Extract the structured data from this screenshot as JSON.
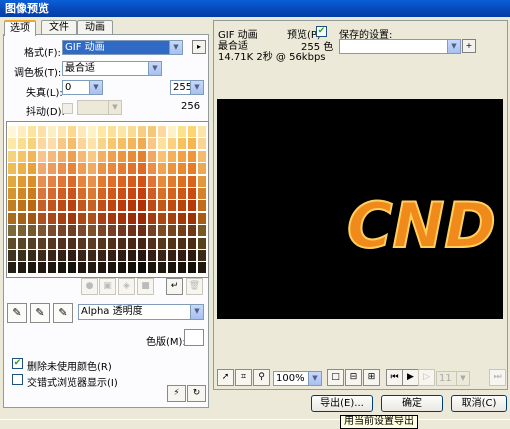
{
  "window": {
    "title": "图像预览"
  },
  "tabs": [
    {
      "label": "选项",
      "active": true
    },
    {
      "label": "文件",
      "active": false
    },
    {
      "label": "动画",
      "active": false
    }
  ],
  "options": {
    "format_label": "格式(F):",
    "format_value": "GIF 动画",
    "palette_label": "调色板(T):",
    "palette_value": "最合适",
    "loss_label": "失真(L):",
    "loss_value": "0",
    "colors_value": "255",
    "dither_label": "抖动(D):",
    "dither_value": "",
    "color_count": "256",
    "alpha_value": "Alpha 透明度",
    "matte_label": "色版(M):",
    "remove_unused_label": "删除未使用颜色(R)",
    "remove_unused_checked": true,
    "interlaced_label": "交错式浏览器显示(I)",
    "interlaced_checked": false
  },
  "preview": {
    "format_text": "GIF 动画",
    "palette_text": "最合适",
    "preview_check_label": "预览(P)",
    "preview_checked": true,
    "colors_text": "255 色",
    "info_text": "14.71K  2秒 @ 56kbps",
    "logo_text": "CND",
    "logo_color": "#f08a1a"
  },
  "saved_settings": {
    "label": "保存的设置:",
    "value": ""
  },
  "zoom": {
    "value": "100%"
  },
  "frame": {
    "value": "11"
  },
  "buttons": {
    "export": "导出(E)...",
    "ok": "确定",
    "cancel": "取消(C)"
  },
  "tooltip": "用当前设置导出",
  "colors": {
    "titlebar": "#0648b8",
    "selection": "#316ac5",
    "accent_tab": "#f5a628"
  },
  "palette_colors": [
    [
      "#fef7d9",
      "#fdeec0",
      "#fbe59e",
      "#fde0a8",
      "#fcefc6",
      "#fde6b3",
      "#fbd98f",
      "#ffe9b8",
      "#fff2c4",
      "#ffe7a4",
      "#fbe198",
      "#fde5a6",
      "#f8dc96",
      "#f7cf84",
      "#f5c878",
      "#fdd8a0",
      "#fef3c6",
      "#fde28e",
      "#fcd570",
      "#fbe5ac"
    ],
    [
      "#fde8a8",
      "#fadd8e",
      "#f8d27a",
      "#fbd7a0",
      "#fcdca8",
      "#f6c886",
      "#f5bc6c",
      "#fbd49a",
      "#fde3a8",
      "#fad38a",
      "#f8c66e",
      "#f6bd62",
      "#f3b45a",
      "#f1aa52",
      "#fac688",
      "#fde09c",
      "#fcd07c",
      "#f9c15e",
      "#f7b54e",
      "#f9d492"
    ],
    [
      "#f6d27c",
      "#f4c468",
      "#f1b756",
      "#f7c48e",
      "#f5b97a",
      "#f2ac64",
      "#eea04e",
      "#f6b874",
      "#f9c882",
      "#f4b062",
      "#f0a04c",
      "#ed9640",
      "#e98c36",
      "#e6822e",
      "#f2a862",
      "#f8c272",
      "#f5b05a",
      "#f2a144",
      "#ef963a",
      "#f4bb6a"
    ],
    [
      "#eebd56",
      "#ebb048",
      "#e8a23a",
      "#f1a86e",
      "#ee9c5c",
      "#eb904a",
      "#e7843a",
      "#f09c54",
      "#f1aa5e",
      "#ec9244",
      "#e8863a",
      "#e57c32",
      "#e2722a",
      "#df6a24",
      "#ea8e48",
      "#f0a450",
      "#ec943c",
      "#e9882e",
      "#e67c26",
      "#ebaa52"
    ],
    [
      "#e2a840",
      "#df9a34",
      "#db8e2a",
      "#e78e52",
      "#e38244",
      "#df7636",
      "#db6a2a",
      "#e5843c",
      "#e8904a",
      "#e27a32",
      "#de6e28",
      "#da6420",
      "#d65c1a",
      "#d35416",
      "#df7436",
      "#e68a3c",
      "#e27a2c",
      "#de6e20",
      "#da641a",
      "#e2983e"
    ],
    [
      "#d49430",
      "#d08826",
      "#cc7c1e",
      "#d8763c",
      "#d46a30",
      "#d05e24",
      "#cc541c",
      "#d66c2c",
      "#da7834",
      "#d46424",
      "#d0581c",
      "#cc4e16",
      "#c84612",
      "#c4400e",
      "#d05c26",
      "#d87028",
      "#d4621c",
      "#d05614",
      "#cc4c10",
      "#d4822c"
    ],
    [
      "#c27e22",
      "#be721a",
      "#ba6814",
      "#c6602a",
      "#c25420",
      "#be4a18",
      "#ba4212",
      "#c45620",
      "#c86224",
      "#c24e18",
      "#be4412",
      "#ba3c0e",
      "#b6360a",
      "#b23008",
      "#be4818",
      "#c45818",
      "#c04c10",
      "#bc420c",
      "#b83a08",
      "#c26c1e"
    ],
    [
      "#a86c1c",
      "#a46218",
      "#a05814",
      "#ac5020",
      "#a84818",
      "#a44012",
      "#a0380e",
      "#aa4818",
      "#ae501a",
      "#a84014",
      "#a4380e",
      "#a0320a",
      "#9c2c08",
      "#982806",
      "#a43c12",
      "#aa4812",
      "#a6400c",
      "#a23808",
      "#9e3206",
      "#a85c18"
    ],
    [
      "#7c6a3a",
      "#786234",
      "#745a2e",
      "#7e5432",
      "#7a4c2c",
      "#764426",
      "#723e22",
      "#7c4a2a",
      "#80522c",
      "#7a4626",
      "#763e22",
      "#72381e",
      "#6e321a",
      "#6a2e18",
      "#764024",
      "#7c4c22",
      "#78441e",
      "#743e1a",
      "#703816",
      "#7a5824"
    ],
    [
      "#5c4c2c",
      "#584628",
      "#544024",
      "#5a3e26",
      "#563822",
      "#52321e",
      "#4e2e1c",
      "#583620",
      "#5c3c22",
      "#56341e",
      "#52301c",
      "#4e2c1a",
      "#4a2818",
      "#462416",
      "#52301c",
      "#58381a",
      "#543218",
      "#502e16",
      "#4c2a14",
      "#58421c"
    ],
    [
      "#3e3420",
      "#3a301c",
      "#362c1a",
      "#3c2a1c",
      "#38261a",
      "#342218",
      "#301e16",
      "#3a2418",
      "#3e281a",
      "#382418",
      "#342016",
      "#301c14",
      "#2c1a12",
      "#281810",
      "#342016",
      "#3a2614",
      "#362214",
      "#321e12",
      "#2e1c10",
      "#3a2c16"
    ],
    [
      "#241e14",
      "#201a12",
      "#1c1810",
      "#221812",
      "#1e1610",
      "#1a140e",
      "#16120c",
      "#20160e",
      "#241a10",
      "#1e160e",
      "#1a140c",
      "#16120a",
      "#121008",
      "#0e0c06",
      "#1a140c",
      "#20180c",
      "#1c140a",
      "#181208",
      "#141006",
      "#201a0c"
    ]
  ]
}
